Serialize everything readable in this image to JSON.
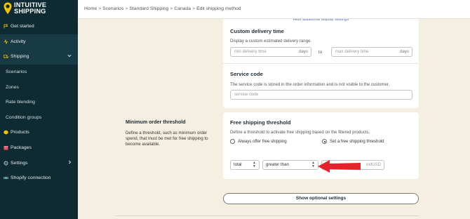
{
  "brand": {
    "line1": "INTUITIVE",
    "line2": "SHIPPING"
  },
  "sidebar": {
    "items": [
      {
        "label": "Get started",
        "icon": "flag-icon"
      },
      {
        "label": "Activity",
        "icon": "activity-icon"
      },
      {
        "label": "Shipping",
        "icon": "truck-icon"
      },
      {
        "label": "Scenarios"
      },
      {
        "label": "Zones"
      },
      {
        "label": "Rate blending"
      },
      {
        "label": "Condition groups"
      },
      {
        "label": "Products",
        "icon": "box-icon"
      },
      {
        "label": "Packages",
        "icon": "package-icon"
      },
      {
        "label": "Settings",
        "icon": "gear-icon"
      },
      {
        "label": "Shopify connection",
        "icon": "link-icon"
      }
    ]
  },
  "breadcrumb": [
    "Home",
    "Scenarios",
    "Standard Shipping",
    "Canada",
    "Edit shipping method"
  ],
  "top_card": {
    "hide_link": "Hide additional display settings",
    "custom_delivery": {
      "title": "Custom delivery time",
      "desc": "Display a custom estimated delivery range.",
      "min_placeholder": "min delivery time",
      "min_suffix": "days",
      "to": "to",
      "max_placeholder": "max delivery time",
      "max_suffix": "days"
    },
    "service_code": {
      "title": "Service code",
      "desc": "The service code is stored in the order information and is not visible to the customer.",
      "placeholder": "service code"
    }
  },
  "min_order": {
    "title": "Minimum order threshold",
    "desc": "Define a threshold, such as minimum order spend, that must be met for free shipping to become available."
  },
  "free_shipping": {
    "title": "Free shipping threshold",
    "desc": "Define a threshold to activate free shipping based on the filtered products.",
    "radio_always": "Always offer free shipping",
    "radio_set": "Set a free shipping threshold",
    "select_total": "total",
    "select_op": "greater than",
    "value_suffix": "USD",
    "value_partial": "old"
  },
  "optional_button": "Show optional settings",
  "colors": {
    "sidebar": "#0e2a33",
    "background": "#f5efe1",
    "accent": "#f5c400",
    "arrow": "#e3242b"
  }
}
